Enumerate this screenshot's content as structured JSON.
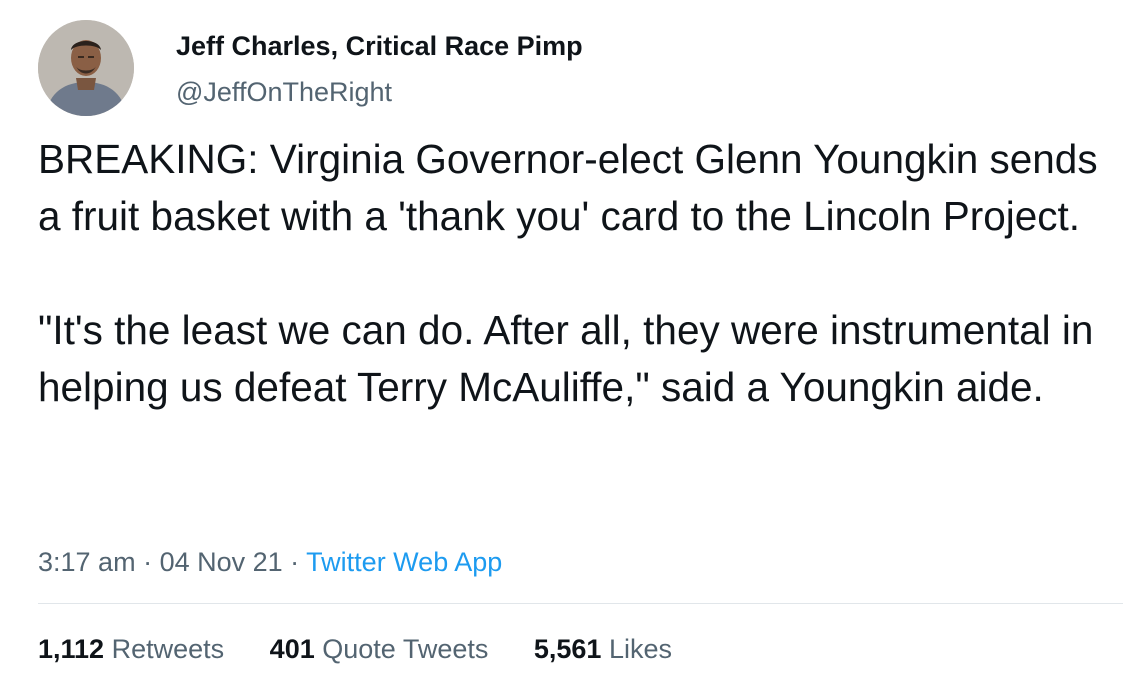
{
  "author": {
    "name": "Jeff Charles, Critical Race Pimp",
    "handle": "@JeffOnTheRight",
    "avatar_icon": "profile-photo"
  },
  "tweet": {
    "paragraphs": [
      "BREAKING: Virginia Governor-elect Glenn Youngkin sends a fruit basket with a 'thank you' card to the Lincoln Project.",
      "\"It's the least we can do. After all, they were instrumental in helping us defeat Terry McAuliffe,\" said a Youngkin aide."
    ]
  },
  "meta": {
    "time": "3:17 am",
    "separator": " · ",
    "date": "04 Nov 21",
    "source": "Twitter Web App"
  },
  "stats": {
    "retweets": {
      "count": "1,112",
      "label": "Retweets"
    },
    "quote_tweets": {
      "count": "401",
      "label": "Quote Tweets"
    },
    "likes": {
      "count": "5,561",
      "label": "Likes"
    }
  },
  "colors": {
    "text": "#0f1419",
    "secondary": "#536471",
    "link": "#1d9bf0",
    "divider": "#e1e6ea"
  }
}
